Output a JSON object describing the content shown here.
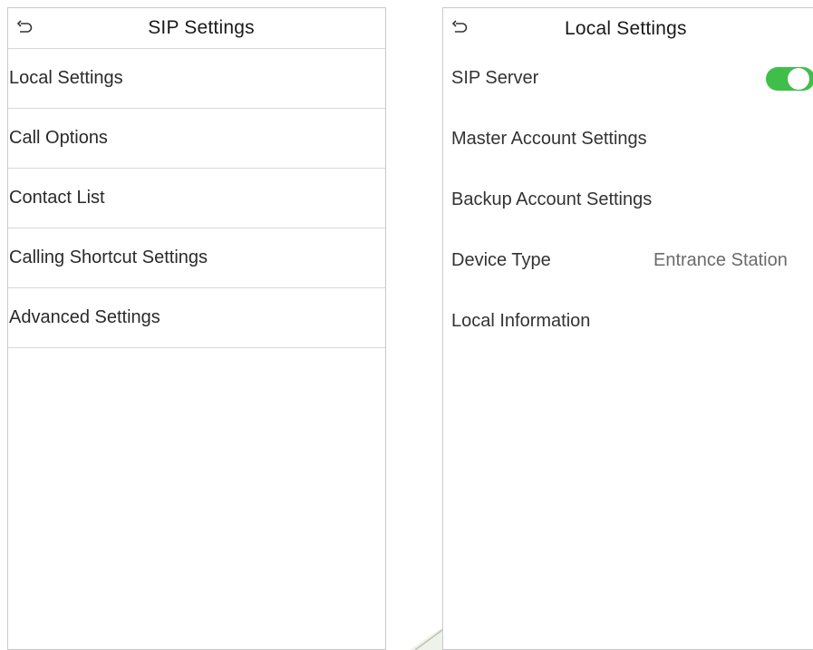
{
  "left_panel": {
    "title": "SIP Settings",
    "back_icon": "undo-arrow-icon",
    "items": [
      {
        "label": "Local Settings"
      },
      {
        "label": "Call Options"
      },
      {
        "label": "Contact List"
      },
      {
        "label": "Calling Shortcut Settings"
      },
      {
        "label": "Advanced Settings"
      }
    ]
  },
  "right_panel": {
    "title": "Local Settings",
    "back_icon": "undo-arrow-icon",
    "items": [
      {
        "label": "SIP Server",
        "toggle": "on"
      },
      {
        "label": "Master Account Settings"
      },
      {
        "label": "Backup Account Settings"
      },
      {
        "label": "Device Type",
        "value": "Entrance Station"
      },
      {
        "label": "Local Information"
      }
    ]
  },
  "colors": {
    "toggle_on": "#3fbf4a",
    "divider": "#d8d8d8",
    "text_primary": "#1a1a1a",
    "text_value": "#6b6b6b"
  }
}
